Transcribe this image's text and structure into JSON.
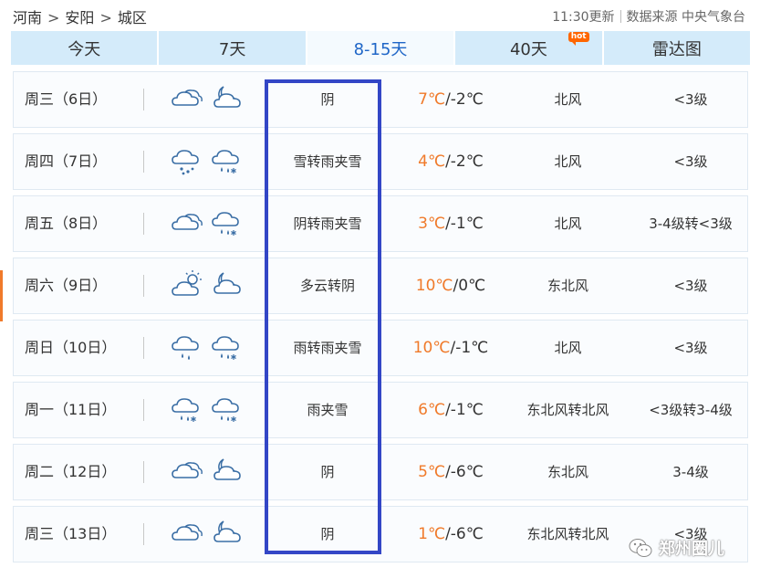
{
  "breadcrumb": {
    "province": "河南",
    "city": "安阳",
    "district": "城区",
    "separator": ">"
  },
  "update": {
    "time": "11:30更新",
    "source": "数据来源 中央气象台"
  },
  "tabs": [
    {
      "label": "今天",
      "active": false
    },
    {
      "label": "7天",
      "active": false
    },
    {
      "label": "8-15天",
      "active": true
    },
    {
      "label": "40天",
      "active": false,
      "badge": "hot"
    },
    {
      "label": "雷达图",
      "active": false
    }
  ],
  "forecast": [
    {
      "day": "周三（6日）",
      "icons": [
        "cloudy-icon",
        "cloudy-night-icon"
      ],
      "desc": "阴",
      "hi": "7℃",
      "lo": "-2℃",
      "wind": "北风",
      "level": "<3级"
    },
    {
      "day": "周四（7日）",
      "icons": [
        "snow-icon",
        "sleet-icon"
      ],
      "desc": "雪转雨夹雪",
      "hi": "4℃",
      "lo": "-2℃",
      "wind": "北风",
      "level": "<3级"
    },
    {
      "day": "周五（8日）",
      "icons": [
        "cloudy-icon",
        "sleet-icon"
      ],
      "desc": "阴转雨夹雪",
      "hi": "3℃",
      "lo": "-1℃",
      "wind": "北风",
      "level": "3-4级转<3级"
    },
    {
      "day": "周六（9日）",
      "icons": [
        "partly-cloudy-icon",
        "cloudy-night-icon"
      ],
      "desc": "多云转阴",
      "hi": "10℃",
      "lo": "0℃",
      "wind": "东北风",
      "level": "<3级"
    },
    {
      "day": "周日（10日）",
      "icons": [
        "rain-icon",
        "sleet-icon"
      ],
      "desc": "雨转雨夹雪",
      "hi": "10℃",
      "lo": "-1℃",
      "wind": "北风",
      "level": "<3级"
    },
    {
      "day": "周一（11日）",
      "icons": [
        "sleet-icon",
        "sleet-icon"
      ],
      "desc": "雨夹雪",
      "hi": "6℃",
      "lo": "-1℃",
      "wind": "东北风转北风",
      "level": "<3级转3-4级"
    },
    {
      "day": "周二（12日）",
      "icons": [
        "cloudy-icon",
        "cloudy-night-icon"
      ],
      "desc": "阴",
      "hi": "5℃",
      "lo": "-6℃",
      "wind": "东北风",
      "level": "3-4级"
    },
    {
      "day": "周三（13日）",
      "icons": [
        "cloudy-icon",
        "cloudy-night-icon"
      ],
      "desc": "阴",
      "hi": "1℃",
      "lo": "-6℃",
      "wind": "东北风转北风",
      "level": "<3级"
    }
  ],
  "watermark": {
    "text": "郑州圈儿",
    "icon": "wechat-icon"
  },
  "colors": {
    "tab_bg": "#d4ebfa",
    "tab_active_text": "#1f66c7",
    "hot_badge": "#ff6600",
    "temp_high": "#f07a2a",
    "highlight_box": "#3346c6",
    "icon_stroke": "#3a6ea5"
  }
}
